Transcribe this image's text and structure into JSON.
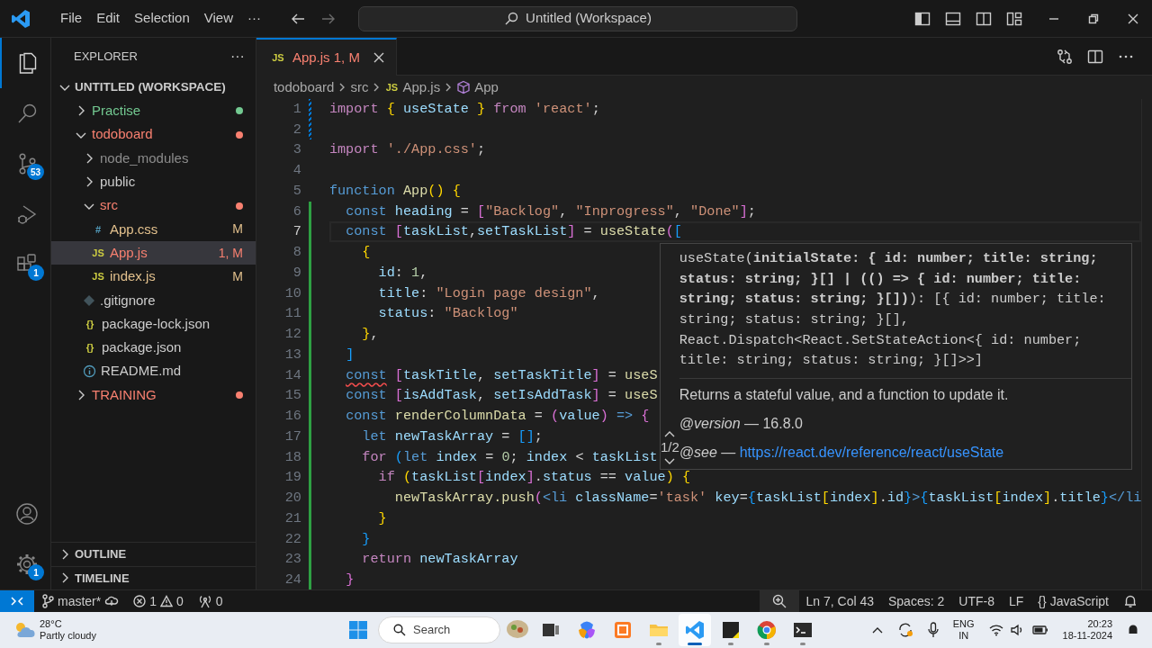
{
  "title_bar": {
    "menus": [
      "File",
      "Edit",
      "Selection",
      "View"
    ],
    "more": "···",
    "search": "Untitled (Workspace)"
  },
  "activity_bar": {
    "items": [
      {
        "kind": "explorer",
        "selected": true
      },
      {
        "kind": "search",
        "selected": false
      },
      {
        "kind": "source-control",
        "selected": false,
        "badge": "53"
      },
      {
        "kind": "run-debug",
        "selected": false
      },
      {
        "kind": "extensions",
        "selected": false,
        "badge": "1"
      }
    ],
    "bottom": [
      {
        "kind": "accounts"
      },
      {
        "kind": "manage",
        "badge": "1"
      }
    ]
  },
  "sidebar": {
    "title": "EXPLORER",
    "more": "···",
    "workspace": {
      "label": "UNTITLED (WORKSPACE)",
      "expanded": true
    },
    "tree": [
      {
        "kind": "folder",
        "label": "Practise",
        "expanded": false,
        "dot": true,
        "color": "#73c991",
        "selected": false
      },
      {
        "kind": "folder",
        "label": "todoboard",
        "expanded": true,
        "dot": true,
        "color": "#f88070",
        "selected": false,
        "children": [
          {
            "kind": "folder",
            "label": "node_modules",
            "expanded": false,
            "dot": false,
            "color": "#8c8c8c",
            "selected": false
          },
          {
            "kind": "folder",
            "label": "public",
            "expanded": false,
            "dot": false,
            "color": "#cccccc",
            "selected": false
          },
          {
            "kind": "folder",
            "label": "src",
            "expanded": true,
            "dot": true,
            "color": "#f88070",
            "selected": false,
            "children": [
              {
                "kind": "css",
                "glyph": "#",
                "label": "App.css",
                "decoration": "M",
                "color": "#e2c08d",
                "selected": false
              },
              {
                "kind": "js",
                "glyph": "JS",
                "label": "App.js",
                "decoration": "1, M",
                "color": "#f88070",
                "selected": true
              },
              {
                "kind": "js",
                "glyph": "JS",
                "label": "index.js",
                "decoration": "M",
                "color": "#e2c08d",
                "selected": false
              }
            ]
          },
          {
            "kind": "git",
            "label": ".gitignore",
            "color": "#cccccc",
            "selected": false
          },
          {
            "kind": "json",
            "glyph": "{}",
            "label": "package-lock.json",
            "color": "#cccccc",
            "selected": false
          },
          {
            "kind": "json",
            "glyph": "{}",
            "label": "package.json",
            "color": "#cccccc",
            "selected": false
          },
          {
            "kind": "info",
            "label": "README.md",
            "color": "#cccccc",
            "selected": false
          }
        ]
      },
      {
        "kind": "folder",
        "label": "TRAINING",
        "expanded": false,
        "dot": true,
        "color": "#f88070",
        "selected": false
      }
    ],
    "sections": [
      {
        "label": "OUTLINE",
        "expanded": false
      },
      {
        "label": "TIMELINE",
        "expanded": false
      }
    ]
  },
  "tabs": [
    {
      "glyph": "JS",
      "label": "App.js",
      "decoration": "1, M",
      "selected": true
    }
  ],
  "breadcrumbs": [
    {
      "kind": "folder",
      "label": "todoboard"
    },
    {
      "kind": "folder",
      "label": "src"
    },
    {
      "kind": "file",
      "glyph": "JS",
      "label": "App.js"
    },
    {
      "kind": "symbol",
      "label": "App"
    }
  ],
  "editor": {
    "lines": [
      {
        "number": "1",
        "modified": true,
        "added": false,
        "current": false,
        "tokens": [
          {
            "kind": "ctl",
            "text": "import"
          },
          {
            "kind": "b1",
            "text": " {"
          },
          {
            "kind": "v",
            "text": " useState"
          },
          {
            "kind": "b1",
            "text": " }"
          },
          {
            "kind": "ctl",
            "text": " from"
          },
          {
            "kind": "s",
            "text": " 'react'"
          },
          {
            "kind": "p",
            "text": ";"
          }
        ]
      },
      {
        "number": "2",
        "modified": true,
        "added": false,
        "current": false
      },
      {
        "number": "3",
        "modified": false,
        "added": false,
        "current": false,
        "tokens": [
          {
            "kind": "ctl",
            "text": "import"
          },
          {
            "kind": "s",
            "text": " './App.css'"
          },
          {
            "kind": "p",
            "text": ";"
          }
        ]
      },
      {
        "number": "4",
        "modified": false,
        "added": false,
        "current": false
      },
      {
        "number": "5",
        "modified": false,
        "added": false,
        "current": false,
        "tokens": [
          {
            "kind": "kw",
            "text": "function"
          },
          {
            "kind": "f",
            "text": " App"
          },
          {
            "kind": "b1",
            "text": "()"
          },
          {
            "kind": "b1",
            "text": " {"
          }
        ]
      },
      {
        "number": "6",
        "modified": false,
        "added": true,
        "current": false,
        "tokens": [
          {
            "kind": "kw",
            "text": "  const"
          },
          {
            "kind": "v",
            "text": " heading"
          },
          {
            "kind": "p",
            "text": " ="
          },
          {
            "kind": "b2",
            "text": " ["
          },
          {
            "kind": "s",
            "text": "\"Backlog\""
          },
          {
            "kind": "p",
            "text": ","
          },
          {
            "kind": "s",
            "text": " \"Inprogress\""
          },
          {
            "kind": "p",
            "text": ","
          },
          {
            "kind": "s",
            "text": " \"Done\""
          },
          {
            "kind": "b2",
            "text": "]"
          },
          {
            "kind": "p",
            "text": ";"
          }
        ]
      },
      {
        "number": "7",
        "modified": false,
        "added": true,
        "current": true,
        "tokens": [
          {
            "kind": "kw",
            "text": "  const"
          },
          {
            "kind": "b2",
            "text": " ["
          },
          {
            "kind": "v",
            "text": "taskList"
          },
          {
            "kind": "p",
            "text": ","
          },
          {
            "kind": "v",
            "text": "setTaskList"
          },
          {
            "kind": "b2",
            "text": "]"
          },
          {
            "kind": "p",
            "text": " ="
          },
          {
            "kind": "f",
            "text": " useState"
          },
          {
            "kind": "b2",
            "text": "("
          },
          {
            "kind": "b3",
            "text": "["
          }
        ]
      },
      {
        "number": "8",
        "modified": false,
        "added": true,
        "current": false,
        "tokens": [
          {
            "kind": "b1",
            "text": "    {"
          }
        ]
      },
      {
        "number": "9",
        "modified": false,
        "added": true,
        "current": false,
        "tokens": [
          {
            "kind": "v",
            "text": "      id"
          },
          {
            "kind": "p",
            "text": ":"
          },
          {
            "kind": "n",
            "text": " 1"
          },
          {
            "kind": "p",
            "text": ","
          }
        ]
      },
      {
        "number": "10",
        "modified": false,
        "added": true,
        "current": false,
        "tokens": [
          {
            "kind": "v",
            "text": "      title"
          },
          {
            "kind": "p",
            "text": ":"
          },
          {
            "kind": "s",
            "text": " \"Login page design\""
          },
          {
            "kind": "p",
            "text": ","
          }
        ]
      },
      {
        "number": "11",
        "modified": false,
        "added": true,
        "current": false,
        "tokens": [
          {
            "kind": "v",
            "text": "      status"
          },
          {
            "kind": "p",
            "text": ":"
          },
          {
            "kind": "s",
            "text": " \"Backlog\""
          }
        ]
      },
      {
        "number": "12",
        "modified": false,
        "added": true,
        "current": false,
        "tokens": [
          {
            "kind": "b1",
            "text": "    }"
          },
          {
            "kind": "p",
            "text": ","
          }
        ]
      },
      {
        "number": "13",
        "modified": false,
        "added": true,
        "current": false,
        "tokens": [
          {
            "kind": "b3",
            "text": "  ]"
          }
        ]
      },
      {
        "number": "14",
        "modified": false,
        "added": true,
        "current": false,
        "tokens": [
          {
            "kind": "kwx",
            "text": "  const"
          },
          {
            "kind": "b2",
            "text": " ["
          },
          {
            "kind": "v",
            "text": "taskTitle"
          },
          {
            "kind": "p",
            "text": ","
          },
          {
            "kind": "v",
            "text": " setTaskTitle"
          },
          {
            "kind": "b2",
            "text": "]"
          },
          {
            "kind": "p",
            "text": " ="
          },
          {
            "kind": "f",
            "text": " useS"
          }
        ]
      },
      {
        "number": "15",
        "modified": false,
        "added": true,
        "current": false,
        "tokens": [
          {
            "kind": "kw",
            "text": "  const"
          },
          {
            "kind": "b2",
            "text": " ["
          },
          {
            "kind": "v",
            "text": "isAddTask"
          },
          {
            "kind": "p",
            "text": ","
          },
          {
            "kind": "v",
            "text": " setIsAddTask"
          },
          {
            "kind": "b2",
            "text": "]"
          },
          {
            "kind": "p",
            "text": " ="
          },
          {
            "kind": "f",
            "text": " useS"
          }
        ]
      },
      {
        "number": "16",
        "modified": false,
        "added": true,
        "current": false,
        "tokens": [
          {
            "kind": "kw",
            "text": "  const"
          },
          {
            "kind": "f",
            "text": " renderColumnData"
          },
          {
            "kind": "p",
            "text": " ="
          },
          {
            "kind": "b2",
            "text": " ("
          },
          {
            "kind": "v",
            "text": "value"
          },
          {
            "kind": "b2",
            "text": ")"
          },
          {
            "kind": "kw",
            "text": " =>"
          },
          {
            "kind": "b2",
            "text": " {"
          }
        ]
      },
      {
        "number": "17",
        "modified": false,
        "added": true,
        "current": false,
        "tokens": [
          {
            "kind": "kw",
            "text": "    let"
          },
          {
            "kind": "v",
            "text": " newTaskArray"
          },
          {
            "kind": "p",
            "text": " ="
          },
          {
            "kind": "b3",
            "text": " []"
          },
          {
            "kind": "p",
            "text": ";"
          }
        ]
      },
      {
        "number": "18",
        "modified": false,
        "added": true,
        "current": false,
        "tokens": [
          {
            "kind": "ctl",
            "text": "    for"
          },
          {
            "kind": "b3",
            "text": " ("
          },
          {
            "kind": "kw",
            "text": "let"
          },
          {
            "kind": "v",
            "text": " index"
          },
          {
            "kind": "p",
            "text": " ="
          },
          {
            "kind": "n",
            "text": " 0"
          },
          {
            "kind": "p",
            "text": ";"
          },
          {
            "kind": "v",
            "text": " index"
          },
          {
            "kind": "p",
            "text": " <"
          },
          {
            "kind": "v",
            "text": " taskList"
          }
        ]
      },
      {
        "number": "19",
        "modified": false,
        "added": true,
        "current": false,
        "tokens": [
          {
            "kind": "ctl",
            "text": "      if"
          },
          {
            "kind": "b1",
            "text": " ("
          },
          {
            "kind": "v",
            "text": "taskList"
          },
          {
            "kind": "b2",
            "text": "["
          },
          {
            "kind": "v",
            "text": "index"
          },
          {
            "kind": "b2",
            "text": "]"
          },
          {
            "kind": "p",
            "text": "."
          },
          {
            "kind": "v",
            "text": "status"
          },
          {
            "kind": "p",
            "text": " =="
          },
          {
            "kind": "v",
            "text": " value"
          },
          {
            "kind": "b1",
            "text": ")"
          },
          {
            "kind": "b1",
            "text": " {"
          }
        ]
      },
      {
        "number": "20",
        "modified": false,
        "added": true,
        "current": false,
        "tokens": [
          {
            "kind": "f",
            "text": "        newTaskArray.push"
          },
          {
            "kind": "b2",
            "text": "("
          },
          {
            "kind": "tag",
            "text": "<li"
          },
          {
            "kind": "v",
            "text": " className"
          },
          {
            "kind": "p",
            "text": "="
          },
          {
            "kind": "s",
            "text": "'task'"
          },
          {
            "kind": "v",
            "text": " key"
          },
          {
            "kind": "p",
            "text": "="
          },
          {
            "kind": "b3",
            "text": "{"
          },
          {
            "kind": "v",
            "text": "taskList"
          },
          {
            "kind": "b1",
            "text": "["
          },
          {
            "kind": "v",
            "text": "index"
          },
          {
            "kind": "b1",
            "text": "]"
          },
          {
            "kind": "p",
            "text": "."
          },
          {
            "kind": "v",
            "text": "id"
          },
          {
            "kind": "b3",
            "text": "}"
          },
          {
            "kind": "tag",
            "text": ">"
          },
          {
            "kind": "b3",
            "text": "{"
          },
          {
            "kind": "v",
            "text": "taskList"
          },
          {
            "kind": "b1",
            "text": "["
          },
          {
            "kind": "v",
            "text": "index"
          },
          {
            "kind": "b1",
            "text": "]"
          },
          {
            "kind": "p",
            "text": "."
          },
          {
            "kind": "v",
            "text": "title"
          },
          {
            "kind": "b3",
            "text": "}"
          },
          {
            "kind": "tag",
            "text": "</li"
          }
        ]
      },
      {
        "number": "21",
        "modified": false,
        "added": true,
        "current": false,
        "tokens": [
          {
            "kind": "b1",
            "text": "      }"
          }
        ]
      },
      {
        "number": "22",
        "modified": false,
        "added": true,
        "current": false,
        "tokens": [
          {
            "kind": "b3",
            "text": "    }"
          }
        ]
      },
      {
        "number": "23",
        "modified": false,
        "added": true,
        "current": false,
        "tokens": [
          {
            "kind": "ctl",
            "text": "    return"
          },
          {
            "kind": "v",
            "text": " newTaskArray"
          }
        ]
      },
      {
        "number": "24",
        "modified": false,
        "added": true,
        "current": false,
        "tokens": [
          {
            "kind": "b2",
            "text": "  }"
          }
        ]
      }
    ],
    "hover": {
      "signature": "useState(**initialState: { id: number; title: string; status: string; }[] | (() => { id: number; title: string; status: string; }[])**): [{ id: number; title: string; status: string; }[], React.Dispatch<React.SetStateAction<{ id: number; title: string; status: string; }[]>>]",
      "description": "Returns a stateful value, and a function to update it.",
      "tags": [
        {
          "name": "@version",
          "text": "— 16.8.0"
        },
        {
          "name": "@see",
          "text": "—",
          "link": "https://react.dev/reference/react/useState"
        }
      ],
      "pager": "1/2"
    }
  },
  "status_bar": {
    "branch": "master*",
    "errors": "1",
    "warnings": "0",
    "ports": "0",
    "position": "Ln 7, Col 43",
    "indent": "Spaces: 2",
    "encoding": "UTF-8",
    "eol": "LF",
    "language_glyph": "{}",
    "language": "JavaScript"
  },
  "taskbar": {
    "weather": {
      "temp": "28°C",
      "condition": "Partly cloudy"
    },
    "search": {
      "placeholder": "Search"
    },
    "apps": [
      {
        "kind": "task-view",
        "running": false,
        "focused": false
      },
      {
        "kind": "copilot",
        "running": false,
        "focused": false
      },
      {
        "kind": "xampp",
        "running": false,
        "focused": false
      },
      {
        "kind": "folder",
        "running": true,
        "focused": false
      },
      {
        "kind": "code",
        "running": true,
        "focused": true
      },
      {
        "kind": "notes",
        "running": true,
        "focused": false
      },
      {
        "kind": "browser",
        "running": true,
        "focused": false
      },
      {
        "kind": "terminal",
        "running": true,
        "focused": false
      }
    ],
    "language": "ENG",
    "region": "IN",
    "time": "20:23",
    "date": "18-11-2024"
  }
}
